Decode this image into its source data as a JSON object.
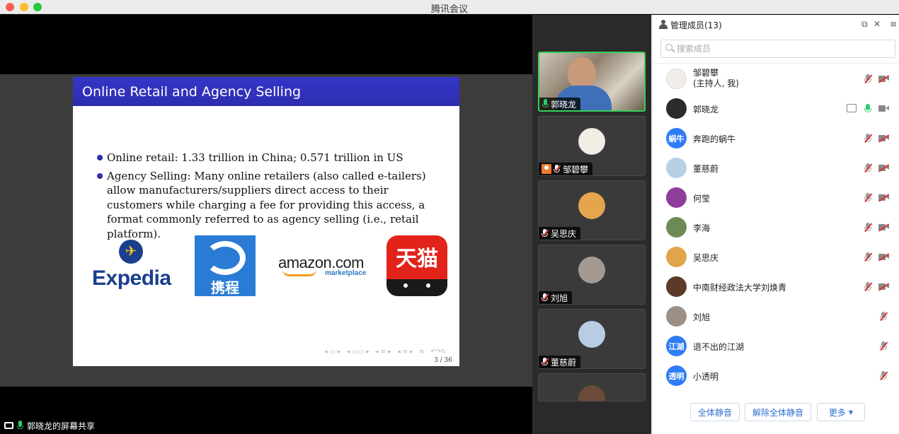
{
  "app": {
    "title": "腾讯会议"
  },
  "slide": {
    "title": "Online Retail and Agency Selling",
    "bullets": [
      "Online retail:  1.33 trillion in China; 0.571 trillion in US",
      "Agency Selling:  Many online retailers (also called e-tailers) allow manufacturers/suppliers direct access to their customers while charging a fee for providing this access, a format commonly referred to as agency selling (i.e., retail platform)."
    ],
    "logos": {
      "expedia": "Expedia",
      "ctrip": "携程",
      "amazon": "amazon.com",
      "amazon_sub": "marketplace",
      "tmall": "天猫"
    },
    "page": "3 / 36"
  },
  "share_label": "郭晓龙的屏幕共享",
  "video_tiles": [
    {
      "name": "郭晓龙"
    },
    {
      "name": "邹碧攀"
    },
    {
      "name": "吴思庆"
    },
    {
      "name": "刘旭"
    },
    {
      "name": "董慈蔚"
    }
  ],
  "panel": {
    "title": "管理成员(13)",
    "search_placeholder": "搜索成员",
    "members": [
      {
        "name": "邹碧攀",
        "sub": "(主持人, 我)",
        "avatar_text": "",
        "avatar_color": "#f2ede6"
      },
      {
        "name": "郭晓龙",
        "sub": "",
        "avatar_text": "",
        "avatar_color": "#2b2b2b"
      },
      {
        "name": "奔跑的蜗牛",
        "sub": "",
        "avatar_text": "蜗牛",
        "avatar_color": "#2f7cf6"
      },
      {
        "name": "董慈蔚",
        "sub": "",
        "avatar_text": "",
        "avatar_color": "#b9cfe6"
      },
      {
        "name": "何莹",
        "sub": "",
        "avatar_text": "",
        "avatar_color": "#8e3f9b"
      },
      {
        "name": "李海",
        "sub": "",
        "avatar_text": "",
        "avatar_color": "#6d8a55"
      },
      {
        "name": "吴思庆",
        "sub": "",
        "avatar_text": "",
        "avatar_color": "#e0a54a"
      },
      {
        "name": "中南财经政法大学刘焕青",
        "sub": "",
        "avatar_text": "",
        "avatar_color": "#5b3a2a"
      },
      {
        "name": "刘旭",
        "sub": "",
        "avatar_text": "",
        "avatar_color": "#9b8f86"
      },
      {
        "name": "退不出的江湖",
        "sub": "",
        "avatar_text": "江湖",
        "avatar_color": "#2f7cf6"
      },
      {
        "name": "小透明",
        "sub": "",
        "avatar_text": "透明",
        "avatar_color": "#2f7cf6"
      }
    ],
    "buttons": {
      "mute_all": "全体静音",
      "unmute_all": "解除全体静音",
      "more": "更多"
    }
  },
  "colors": {
    "accent": "#2f6fd1",
    "active_speaker": "#33d25b",
    "slide_header": "#3333c0"
  }
}
